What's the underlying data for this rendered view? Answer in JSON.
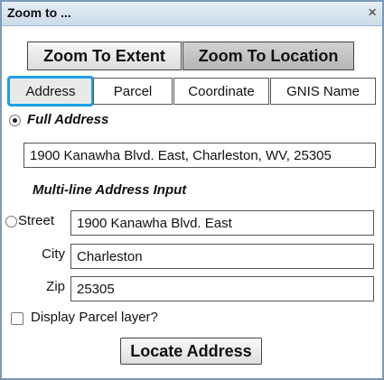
{
  "dialog": {
    "title": "Zoom to ...",
    "close_symbol": "×"
  },
  "mode_buttons": {
    "extent_label": "Zoom To Extent",
    "location_label": "Zoom To Location"
  },
  "tabs": [
    {
      "label": "Address",
      "selected": true
    },
    {
      "label": "Parcel",
      "selected": false
    },
    {
      "label": "Coordinate",
      "selected": false
    },
    {
      "label": "GNIS Name",
      "selected": false
    }
  ],
  "full_address": {
    "heading": "Full Address",
    "selected": true,
    "value": "1900 Kanawha Blvd. East, Charleston, WV, 25305"
  },
  "multi_line": {
    "heading": "Multi-line Address Input",
    "selected": false,
    "street_label": "Street",
    "street_value": "1900 Kanawha Blvd. East",
    "city_label": "City",
    "city_value": "Charleston",
    "zip_label": "Zip",
    "zip_value": "25305"
  },
  "parcel_layer": {
    "label": "Display Parcel layer?",
    "checked": false
  },
  "locate_button": {
    "label": "Locate Address"
  },
  "colors": {
    "tab_highlight": "#1fa0e6",
    "titlebar": "#cbdbe9",
    "dialog_border": "#7a9bb8"
  },
  "icons": {
    "close": "close-icon"
  }
}
